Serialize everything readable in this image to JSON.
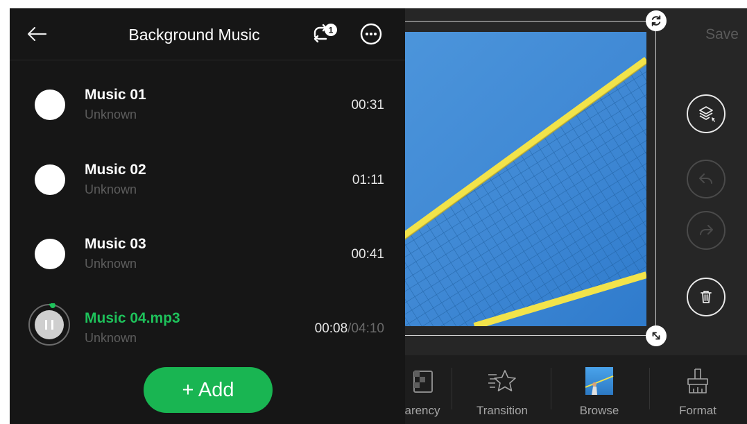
{
  "editor": {
    "save_label": "Save",
    "bottom_tabs": [
      {
        "label": "arency",
        "icon": "transparency-icon"
      },
      {
        "label": "Transition",
        "icon": "transition-star-icon"
      },
      {
        "label": "Browse",
        "icon": "browse-photo-icon"
      },
      {
        "label": "Format",
        "icon": "format-brush-icon"
      }
    ],
    "side_tools": [
      "layers-select-icon",
      "undo-icon",
      "redo-icon",
      "delete-icon"
    ]
  },
  "panel": {
    "title": "Background Music",
    "loop_badge": "1",
    "add_label": "+ Add",
    "tracks": [
      {
        "name": "Music 01",
        "artist": "Unknown",
        "duration": "00:31"
      },
      {
        "name": "Music 02",
        "artist": "Unknown",
        "duration": "01:11"
      },
      {
        "name": "Music 03",
        "artist": "Unknown",
        "duration": "00:41"
      },
      {
        "name": "Music 04.mp3",
        "artist": "Unknown",
        "elapsed": "00:08",
        "total": "/04:10",
        "playing": true
      }
    ]
  },
  "colors": {
    "accent_green": "#19b552",
    "active_text": "#1ec25b",
    "panel_bg": "#161616"
  }
}
